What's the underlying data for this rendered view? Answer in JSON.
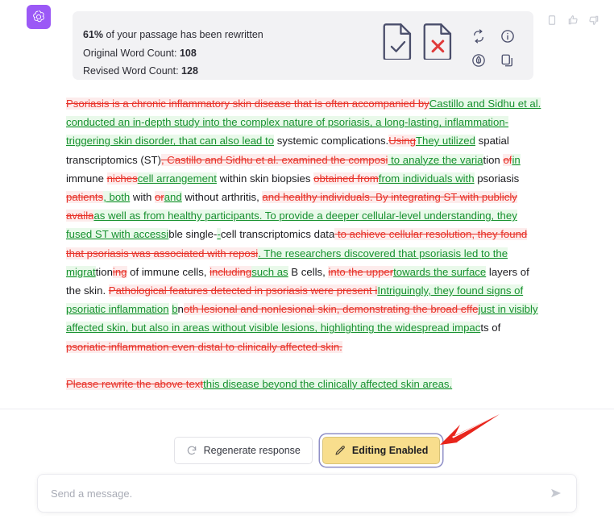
{
  "avatar": {
    "name": "chatgpt-logo"
  },
  "message_actions": [
    {
      "name": "clipboard-icon",
      "label": "Copy"
    },
    {
      "name": "thumbs-up-icon",
      "label": "Good response"
    },
    {
      "name": "thumbs-down-icon",
      "label": "Bad response"
    }
  ],
  "stats": {
    "rewritten_percent": "61%",
    "rewritten_suffix": " of your passage has been rewritten",
    "original_label": "Original Word Count: ",
    "original_value": "108",
    "revised_label": "Revised Word Count: ",
    "revised_value": "128"
  },
  "panel_icons": [
    {
      "name": "accept-document-icon",
      "label": "Accept all changes"
    },
    {
      "name": "reject-document-icon",
      "label": "Reject all changes"
    },
    {
      "name": "loop-refresh-icon",
      "label": "Retry rewrite"
    },
    {
      "name": "info-icon",
      "label": "Info"
    },
    {
      "name": "feather-circle-icon",
      "label": "Rewrite style"
    },
    {
      "name": "copy-icon",
      "label": "Copy text"
    }
  ],
  "diff": {
    "lines": [
      [
        {
          "t": "del",
          "s": "Psoriasis is a chronic inflammatory skin disease that is often accompanied by"
        },
        {
          "t": "ins",
          "s": "Castillo and Sidhu et al. conducted an in-depth study into the complex nature of psoriasis, a long-lasting, inflammation-triggering skin disorder, that can also lead to"
        },
        {
          "t": "eq",
          "s": " systemic complications."
        }
      ],
      [
        {
          "t": "del",
          "s": "Using"
        },
        {
          "t": "ins",
          "s": "They utilized"
        },
        {
          "t": "eq",
          "s": " spatial transcriptomics (ST)"
        },
        {
          "t": "del",
          "s": ", Castillo and Sidhu et al. examined the composi"
        },
        {
          "t": "ins",
          "s": " to analyze the varia"
        },
        {
          "t": "eq",
          "s": "tion "
        },
        {
          "t": "del",
          "s": "of"
        },
        {
          "t": "ins",
          "s": "in"
        },
        {
          "t": "eq",
          "s": " immune "
        },
        {
          "t": "del",
          "s": "niches"
        },
        {
          "t": "ins",
          "s": "cell arrangement"
        },
        {
          "t": "eq",
          "s": " within skin biopsies "
        },
        {
          "t": "del",
          "s": "obtained from"
        },
        {
          "t": "ins",
          "s": "from individuals with"
        },
        {
          "t": "eq",
          "s": " psoriasis"
        },
        {
          "t": "del",
          "s": " patients"
        },
        {
          "t": "ins",
          "s": ", both"
        },
        {
          "t": "eq",
          "s": " with "
        },
        {
          "t": "del",
          "s": "or"
        },
        {
          "t": "ins",
          "s": "and"
        },
        {
          "t": "eq",
          "s": " without arthritis, "
        },
        {
          "t": "del",
          "s": "and healthy individuals. By integrating ST with publicly availa"
        },
        {
          "t": "ins",
          "s": "as well as from healthy participants. To provide a deeper cellular-level understanding, they fused ST with accessi"
        },
        {
          "t": "eq",
          "s": "ble single-"
        },
        {
          "t": "ins",
          "s": "-"
        },
        {
          "t": "eq",
          "s": "cell transcriptomics data"
        },
        {
          "t": "del",
          "s": " to achieve cellular resolution, they found that psoriasis was associated with reposi"
        },
        {
          "t": "ins",
          "s": ". The researchers discovered that psoriasis led to the migrat"
        },
        {
          "t": "eq",
          "s": "tion"
        },
        {
          "t": "del",
          "s": "ing"
        },
        {
          "t": "eq",
          "s": " of immune cells, "
        },
        {
          "t": "del",
          "s": "including"
        },
        {
          "t": "ins",
          "s": "such as"
        },
        {
          "t": "eq",
          "s": " B cells, "
        },
        {
          "t": "del",
          "s": "into the upper"
        },
        {
          "t": "ins",
          "s": "towards the surface"
        },
        {
          "t": "eq",
          "s": " layers of the skin. "
        },
        {
          "t": "del",
          "s": "Pathological features detected in psoriasis were present i"
        },
        {
          "t": "ins",
          "s": "Intriguingly, they found signs of psoriatic inflammation"
        },
        {
          "t": "eq",
          "s": " "
        },
        {
          "t": "ins",
          "s": "b"
        },
        {
          "t": "eq",
          "s": "n"
        },
        {
          "t": "del",
          "s": "ot"
        },
        {
          "t": "del",
          "s": "h lesional and nonlesional skin, demonstrating the broad effe"
        },
        {
          "t": "ins",
          "s": "just in visibly affected skin, but also in areas without visible lesions, highlighting the widespread impac"
        },
        {
          "t": "eq",
          "s": "ts of "
        },
        {
          "t": "del",
          "s": "psoriatic inflammation even distal to clinically affected skin."
        }
      ]
    ],
    "final_line": [
      {
        "t": "del",
        "s": "Please rewrite the above text"
      },
      {
        "t": "ins",
        "s": "this disease beyond the clinically affected skin areas."
      }
    ],
    "colors": {
      "deleted": "#e8332a",
      "inserted": "#17912f",
      "unchanged": "#1b1b1f",
      "deleted_bg": "#fdecec",
      "inserted_bg": "#e9f9ea"
    }
  },
  "footer": {
    "regenerate_label": "Regenerate response",
    "editing_label": "Editing Enabled",
    "regenerate_icon": "refresh-icon",
    "editing_icon": "pen-icon",
    "editing_accent": "#f8de8d"
  },
  "composer": {
    "placeholder": "Send a message.",
    "value": "",
    "send_icon": "send-arrow-icon"
  },
  "annotation": {
    "name": "red-pointer-arrow",
    "color": "#e8251c"
  }
}
